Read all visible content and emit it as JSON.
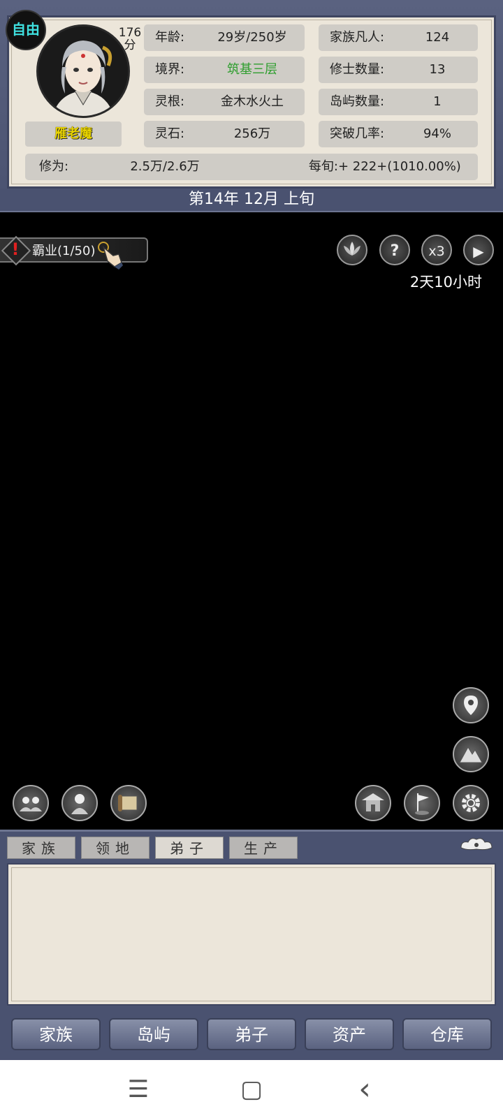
{
  "status_badge": "自由",
  "score": {
    "value": "176",
    "unit": "分"
  },
  "player_name": "雁老魔",
  "stats": {
    "age": {
      "label": "年龄:",
      "value": "29岁/250岁"
    },
    "realm": {
      "label": "境界:",
      "value": "筑基三层",
      "color": "#2e9e2e"
    },
    "spirit_root": {
      "label": "灵根:",
      "value": "金木水火土"
    },
    "spirit_stone": {
      "label": "灵石:",
      "value": "256万"
    },
    "family_mortals": {
      "label": "家族凡人:",
      "value": "124"
    },
    "cultivators": {
      "label": "修士数量:",
      "value": "13"
    },
    "islands": {
      "label": "岛屿数量:",
      "value": "1"
    },
    "breakthrough": {
      "label": "突破几率:",
      "value": "94%"
    },
    "cultivation": {
      "label": "修为:",
      "value": "2.5万/2.6万"
    },
    "per_period": {
      "label": "每旬:",
      "value": "+ 222+(1010.00%)"
    }
  },
  "date": "第14年 12月 上旬",
  "quest": {
    "label": "霸业(1/50)"
  },
  "controls": {
    "help": "?",
    "speed": "x3",
    "play": "▶"
  },
  "countdown": "2天10小时",
  "tabs": [
    {
      "label": "家族",
      "active": false
    },
    {
      "label": "领地",
      "active": false
    },
    {
      "label": "弟子",
      "active": true
    },
    {
      "label": "生产",
      "active": false
    }
  ],
  "nav": [
    "家族",
    "岛屿",
    "弟子",
    "资产",
    "仓库"
  ],
  "system": {
    "menu": "☰",
    "home": "▢",
    "back": "‹"
  }
}
